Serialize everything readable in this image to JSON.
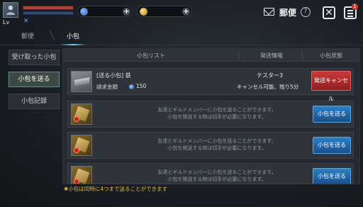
{
  "player": {
    "level_label": "Lv"
  },
  "header": {
    "title": "郵便",
    "help_label": "?",
    "close_label": "✕",
    "notification_count": "1"
  },
  "tabs": [
    {
      "label": "郵便"
    },
    {
      "label": "小包"
    }
  ],
  "sidebar": {
    "items": [
      {
        "label": "受け取った小包"
      },
      {
        "label": "小包を送る"
      },
      {
        "label": "小包記録"
      }
    ]
  },
  "table": {
    "headers": [
      "小包リスト",
      "発送情報",
      "小包状態"
    ],
    "rows": [
      {
        "name": "[送る小包] 鉄",
        "price_label": "請求金額",
        "price": "150",
        "send_info": "テスター3",
        "status": "キャンセル可能、残り5分",
        "button": "発送キャンセル"
      },
      {
        "desc_line1": "友達とギルドメンバーに小包を送ることができます。",
        "desc_line2": "小包を発送する時は切手が必要になります。",
        "button": "小包を送る"
      },
      {
        "desc_line1": "友達とギルドメンバーに小包を送ることができます。",
        "desc_line2": "小包を発送する時は切手が必要になります。",
        "button": "小包を送る"
      },
      {
        "desc_line1": "友達とギルドメンバーに小包を送ることができます。",
        "desc_line2": "小包を発送する時は切手が必要になります。",
        "button": "小包を送る"
      }
    ]
  },
  "footer": {
    "note": "✱小包は同時に4つまで送ることができます"
  },
  "colors": {
    "accent_blue": "#2d7fc6",
    "cancel_red": "#c8393a",
    "note_gold": "#e6b93a"
  }
}
